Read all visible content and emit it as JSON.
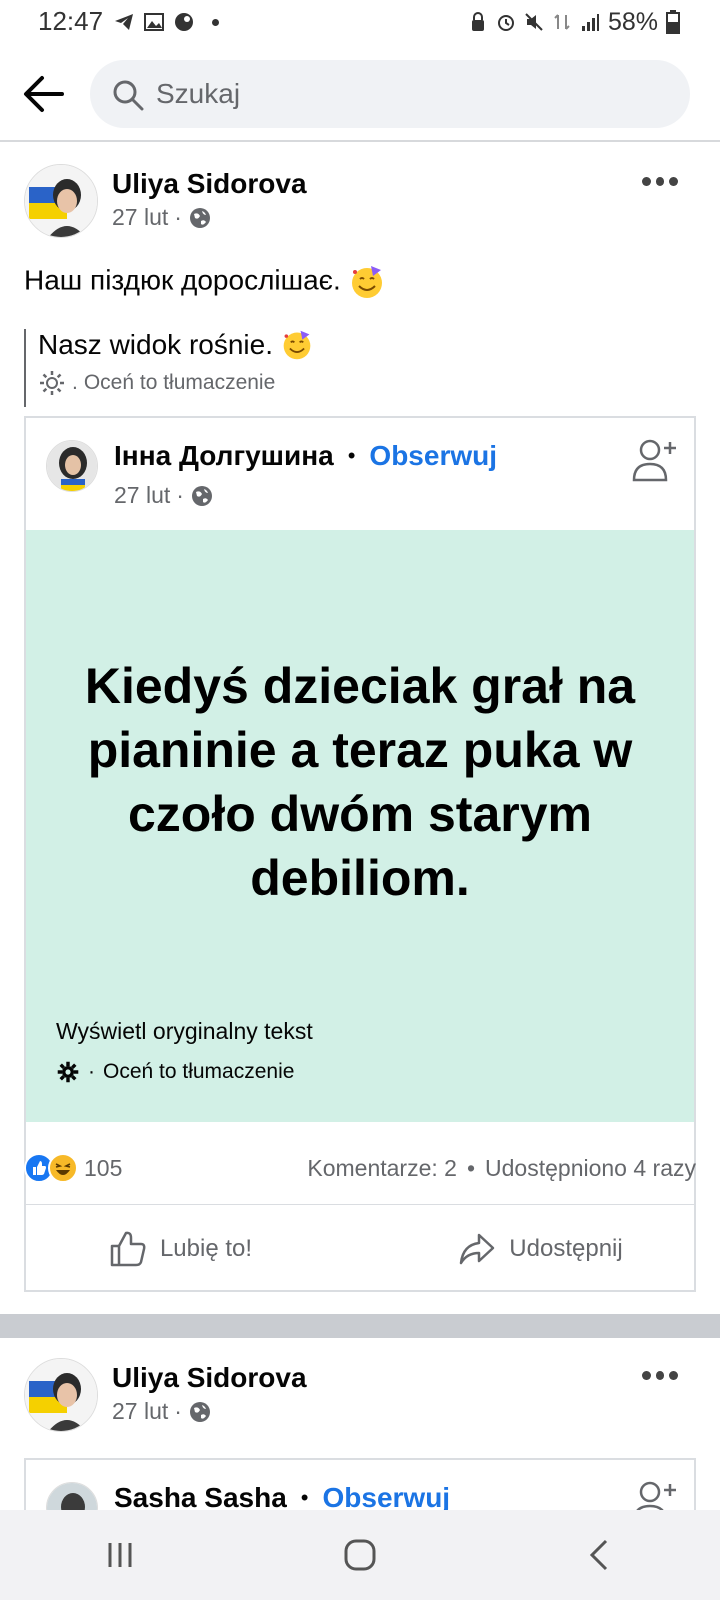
{
  "status_bar": {
    "time": "12:47",
    "battery": "58%"
  },
  "search": {
    "placeholder": "Szukaj"
  },
  "posts": [
    {
      "author": "Uliya Sidorova",
      "date": "27 lut",
      "text": "Наш піздюк дорослішає.",
      "translation": "Nasz widok rośnie.",
      "rate_translation": "Oceń to tłumaczenie",
      "shared": {
        "author": "Інна Долгушина",
        "follow": "Obserwuj",
        "date": "27 lut",
        "body": "Kiedyś dzieciak grał na pianinie a teraz puka w czoło dwóm starym debiliom.",
        "show_original": "Wyświetl oryginalny tekst",
        "rate_translation": "Oceń to tłumaczenie"
      },
      "reactions_count": "105",
      "comments": "Komentarze: 2",
      "shares": "Udostępniono 4 razy",
      "like_label": "Lubię to!",
      "share_label": "Udostępnij"
    },
    {
      "author": "Uliya Sidorova",
      "date": "27 lut",
      "shared": {
        "author": "Sasha Sasha",
        "follow": "Obserwuj"
      }
    }
  ],
  "colors": {
    "link_blue": "#1b74e4",
    "panel_green": "#d2f0e6",
    "muted": "#65676b"
  }
}
